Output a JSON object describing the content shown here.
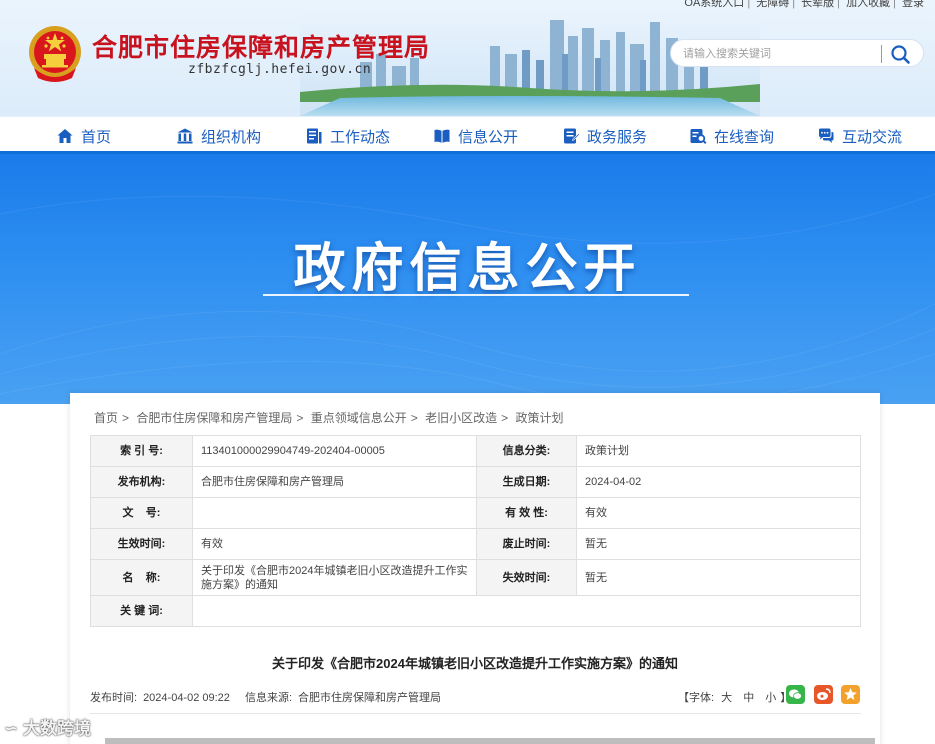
{
  "header": {
    "top_links": [
      "OA系统入口",
      "无障碍",
      "长辈版",
      "加入收藏",
      "登录"
    ],
    "site_title": "合肥市住房保障和房产管理局",
    "site_domain": "zfbzfcglj.hefei.gov.cn",
    "search_placeholder": "请输入搜索关键词"
  },
  "nav": {
    "items": [
      {
        "label": "首页",
        "icon": "home-icon"
      },
      {
        "label": "组织机构",
        "icon": "building-icon"
      },
      {
        "label": "工作动态",
        "icon": "news-icon"
      },
      {
        "label": "信息公开",
        "icon": "book-icon"
      },
      {
        "label": "政务服务",
        "icon": "service-icon"
      },
      {
        "label": "在线查询",
        "icon": "query-icon"
      },
      {
        "label": "互动交流",
        "icon": "chat-icon"
      }
    ]
  },
  "banner": {
    "title": "政府信息公开"
  },
  "breadcrumb": [
    "首页",
    "合肥市住房保障和房产管理局",
    "重点领域信息公开",
    "老旧小区改造",
    "政策计划"
  ],
  "meta": {
    "index_label": "索 引 号:",
    "index_value": "113401000029904749-202404-00005",
    "category_label": "信息分类:",
    "category_value": "政策计划",
    "publisher_label": "发布机构:",
    "publisher_value": "合肥市住房保障和房产管理局",
    "created_label": "生成日期:",
    "created_value": "2024-04-02",
    "docno_label": "文    号:",
    "docno_value": "",
    "validity_label": "有 效 性:",
    "validity_value": "有效",
    "effective_label": "生效时间:",
    "effective_value": "有效",
    "repeal_label": "废止时间:",
    "repeal_value": "暂无",
    "name_label": "名    称:",
    "name_value": "关于印发《合肥市2024年城镇老旧小区改造提升工作实施方案》的通知",
    "expire_label": "失效时间:",
    "expire_value": "暂无",
    "keywords_label": "关 键 词:",
    "keywords_value": ""
  },
  "document": {
    "title": "关于印发《合肥市2024年城镇老旧小区改造提升工作实施方案》的通知",
    "publish_time_label": "发布时间:",
    "publish_time": "2024-04-02 09:22",
    "source_label": "信息来源:",
    "source": "合肥市住房保障和房产管理局",
    "font_label_open": "【字体:",
    "font_sizes": [
      "大",
      "中",
      "小"
    ],
    "font_label_close": "】"
  },
  "share": [
    {
      "name": "wechat-share-icon",
      "color": "#35b54a"
    },
    {
      "name": "weibo-share-icon",
      "color": "#e8572a"
    },
    {
      "name": "favorite-star-icon",
      "color": "#f2a22c"
    }
  ],
  "watermark": "大数跨境"
}
